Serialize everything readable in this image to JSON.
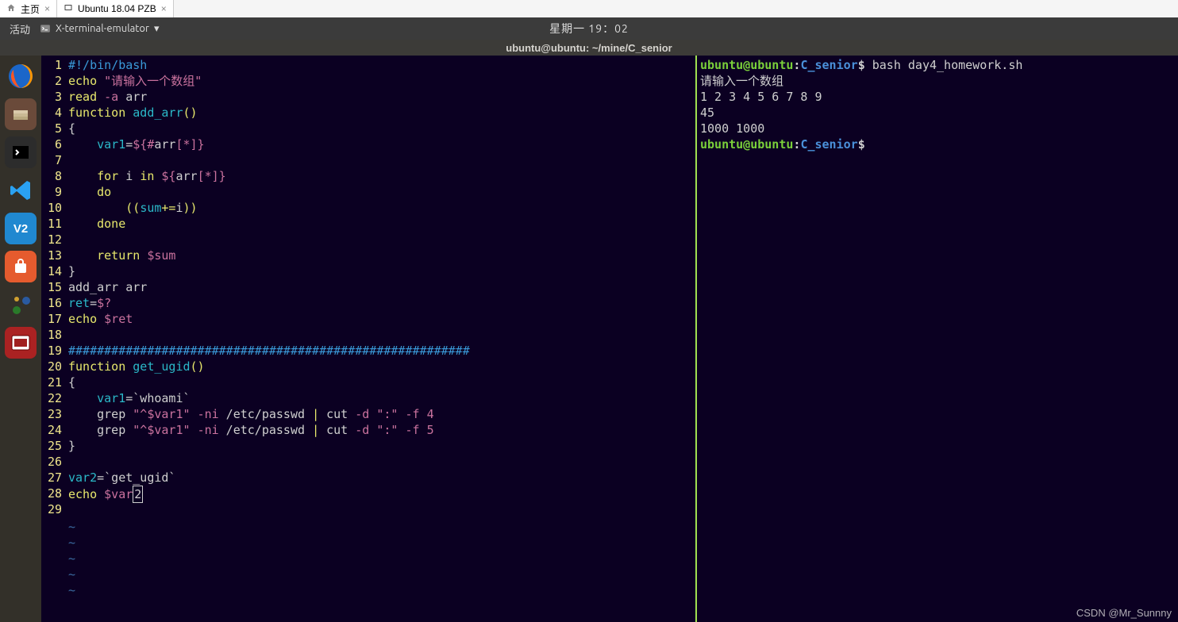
{
  "tabs": [
    {
      "label": "主页"
    },
    {
      "label": "Ubuntu 18.04 PZB"
    }
  ],
  "panel": {
    "activities": "活动",
    "app_name": "X-terminal-emulator",
    "clock": "星期一 19：02"
  },
  "terminal_title": "ubuntu@ubuntu: ~/mine/C_senior",
  "editor": {
    "line_start": 1,
    "line_end": 29,
    "lines": [
      [
        [
          "c-com",
          "#!/bin/bash"
        ]
      ],
      [
        [
          "c-kw",
          "echo"
        ],
        [
          "c-op",
          " "
        ],
        [
          "c-str",
          "\"请输入一个数组\""
        ]
      ],
      [
        [
          "c-kw",
          "read"
        ],
        [
          "c-op",
          " "
        ],
        [
          "c-pre",
          "-a"
        ],
        [
          "c-op",
          " arr"
        ]
      ],
      [
        [
          "c-kw",
          "function"
        ],
        [
          "c-op",
          " "
        ],
        [
          "c-fn",
          "add_arr"
        ],
        [
          "c-kw",
          "()"
        ]
      ],
      [
        [
          "c-op",
          "{"
        ]
      ],
      [
        [
          "c-op",
          "    "
        ],
        [
          "c-id",
          "var1"
        ],
        [
          "c-op",
          "="
        ],
        [
          "c-pre",
          "${#"
        ],
        [
          "c-op",
          "arr"
        ],
        [
          "c-pre",
          "[*]}"
        ]
      ],
      [
        [
          "c-op",
          ""
        ]
      ],
      [
        [
          "c-op",
          "    "
        ],
        [
          "c-kw",
          "for"
        ],
        [
          "c-op",
          " i "
        ],
        [
          "c-kw",
          "in"
        ],
        [
          "c-op",
          " "
        ],
        [
          "c-pre",
          "${"
        ],
        [
          "c-op",
          "arr"
        ],
        [
          "c-pre",
          "[*]}"
        ]
      ],
      [
        [
          "c-op",
          "    "
        ],
        [
          "c-kw",
          "do"
        ]
      ],
      [
        [
          "c-op",
          "        "
        ],
        [
          "c-kw",
          "(("
        ],
        [
          "c-id",
          "sum"
        ],
        [
          "c-kw",
          "+="
        ],
        [
          "c-op",
          "i"
        ],
        [
          "c-kw",
          "))"
        ]
      ],
      [
        [
          "c-op",
          "    "
        ],
        [
          "c-kw",
          "done"
        ]
      ],
      [
        [
          "c-op",
          ""
        ]
      ],
      [
        [
          "c-op",
          "    "
        ],
        [
          "c-kw",
          "return"
        ],
        [
          "c-op",
          " "
        ],
        [
          "c-pre",
          "$sum"
        ]
      ],
      [
        [
          "c-op",
          "}"
        ]
      ],
      [
        [
          "c-op",
          "add_arr arr"
        ]
      ],
      [
        [
          "c-id",
          "ret"
        ],
        [
          "c-op",
          "="
        ],
        [
          "c-pre",
          "$?"
        ]
      ],
      [
        [
          "c-kw",
          "echo"
        ],
        [
          "c-op",
          " "
        ],
        [
          "c-pre",
          "$ret"
        ]
      ],
      [
        [
          "c-op",
          ""
        ]
      ],
      [
        [
          "c-com",
          "########################################################"
        ]
      ],
      [
        [
          "c-kw",
          "function"
        ],
        [
          "c-op",
          " "
        ],
        [
          "c-fn",
          "get_ugid"
        ],
        [
          "c-kw",
          "()"
        ]
      ],
      [
        [
          "c-op",
          "{"
        ]
      ],
      [
        [
          "c-op",
          "    "
        ],
        [
          "c-id",
          "var1"
        ],
        [
          "c-op",
          "=`whoami`"
        ]
      ],
      [
        [
          "c-op",
          "    grep "
        ],
        [
          "c-str",
          "\"^$var1\""
        ],
        [
          "c-op",
          " "
        ],
        [
          "c-pre",
          "-ni"
        ],
        [
          "c-op",
          " /etc/passwd "
        ],
        [
          "c-kw",
          "|"
        ],
        [
          "c-op",
          " cut "
        ],
        [
          "c-pre",
          "-d"
        ],
        [
          "c-op",
          " "
        ],
        [
          "c-str",
          "\":\""
        ],
        [
          "c-op",
          " "
        ],
        [
          "c-pre",
          "-f"
        ],
        [
          "c-op",
          " "
        ],
        [
          "c-num",
          "4"
        ]
      ],
      [
        [
          "c-op",
          "    grep "
        ],
        [
          "c-str",
          "\"^$var1\""
        ],
        [
          "c-op",
          " "
        ],
        [
          "c-pre",
          "-ni"
        ],
        [
          "c-op",
          " /etc/passwd "
        ],
        [
          "c-kw",
          "|"
        ],
        [
          "c-op",
          " cut "
        ],
        [
          "c-pre",
          "-d"
        ],
        [
          "c-op",
          " "
        ],
        [
          "c-str",
          "\":\""
        ],
        [
          "c-op",
          " "
        ],
        [
          "c-pre",
          "-f"
        ],
        [
          "c-op",
          " "
        ],
        [
          "c-num",
          "5"
        ]
      ],
      [
        [
          "c-op",
          "}"
        ]
      ],
      [
        [
          "c-op",
          ""
        ]
      ],
      [
        [
          "c-id",
          "var2"
        ],
        [
          "c-op",
          "=`get_ugid`"
        ]
      ],
      [
        [
          "c-kw",
          "echo"
        ],
        [
          "c-op",
          " "
        ],
        [
          "c-pre",
          "$var"
        ],
        [
          "cursor",
          "2"
        ]
      ],
      [
        [
          "c-op",
          ""
        ]
      ]
    ],
    "tildes": 5
  },
  "terminal": {
    "prompt_user": "ubuntu@ubuntu",
    "prompt_sep1": ":",
    "prompt_path": "C_senior",
    "prompt_sep2": "$",
    "lines": [
      {
        "type": "prompt",
        "cmd": " bash day4_homework.sh"
      },
      {
        "type": "out",
        "text": "请输入一个数组"
      },
      {
        "type": "out",
        "text": "1 2 3 4 5 6 7 8 9"
      },
      {
        "type": "out",
        "text": "45"
      },
      {
        "type": "out",
        "text": "1000 1000"
      },
      {
        "type": "prompt",
        "cmd": " "
      }
    ]
  },
  "dock_icons": [
    {
      "name": "firefox-icon",
      "bg": "transparent",
      "glyph": "ff"
    },
    {
      "name": "files-icon",
      "bg": "#6a4a3a",
      "glyph": "files"
    },
    {
      "name": "terminal-icon",
      "bg": "#2c2c2c",
      "glyph": "term"
    },
    {
      "name": "vscode-icon",
      "bg": "transparent",
      "glyph": "vs"
    },
    {
      "name": "vpn-icon",
      "bg": "#2088d0",
      "glyph": "V2"
    },
    {
      "name": "software-icon",
      "bg": "#e55b2e",
      "glyph": "bag"
    },
    {
      "name": "network-icon",
      "bg": "transparent",
      "glyph": "net"
    },
    {
      "name": "screenshot-icon",
      "bg": "#aa2222",
      "glyph": "rec"
    }
  ],
  "watermark": "CSDN @Mr_Sunnny"
}
